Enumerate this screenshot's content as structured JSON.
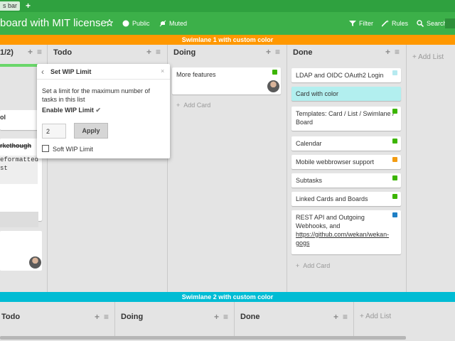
{
  "topbar": {
    "tab_label": "s bar",
    "add_tab": "+"
  },
  "header": {
    "board_title": "board with MIT license",
    "star_icon": "star-icon",
    "visibility": "Public",
    "notifications": "Muted",
    "filter": "Filter",
    "rules": "Rules",
    "search": "Search"
  },
  "swimlanes": [
    {
      "title": "Swimlane 1 with custom color",
      "color": "#ff9800",
      "lists": [
        {
          "title": "1/2)",
          "cards": [
            {
              "text": "ol"
            },
            {
              "text": "rkethough"
            },
            {
              "text": "eformatted"
            },
            {
              "text": "st"
            }
          ]
        },
        {
          "title": "Todo",
          "add_label": "+",
          "menu": "≡"
        },
        {
          "title": "Doing",
          "cards": [
            {
              "text": "More features",
              "label_color": "#3cb500"
            }
          ],
          "add_card": "Add Card"
        },
        {
          "title": "Done",
          "cards": [
            {
              "text": "LDAP and OIDC OAuth2 Login",
              "label_color": "#b6eaf0"
            },
            {
              "text": "Card with color",
              "card_color": "#b2efef"
            },
            {
              "text": "Templates: Card / List / Swimlane / Board",
              "label_color": "#3cb500"
            },
            {
              "text": "Calendar",
              "label_color": "#3cb500"
            },
            {
              "text": "Mobile webbrowser support",
              "label_color": "#f39c12"
            },
            {
              "text": "Subtasks",
              "label_color": "#3cb500"
            },
            {
              "text": "Linked Cards and Boards",
              "label_color": "#3cb500"
            },
            {
              "text": "REST API and Outgoing Webhooks, and",
              "link": "https://github.com/wekan/wekan-gogs",
              "label_color": "#1e7fc5"
            }
          ],
          "add_card": "Add Card"
        }
      ],
      "add_list": "Add List"
    },
    {
      "title": "Swimlane 2 with custom color",
      "color": "#00bcd4",
      "lists": [
        {
          "title": "Todo"
        },
        {
          "title": "Doing"
        },
        {
          "title": "Done"
        }
      ],
      "add_list": "Add List"
    }
  ],
  "wip_popup": {
    "title": "Set WIP Limit",
    "close": "×",
    "description": "Set a limit for the maximum number of tasks in this list",
    "enable_label": "Enable WIP Limit",
    "check": "✔",
    "value": "2",
    "apply": "Apply",
    "soft_label": "Soft WIP Limit"
  },
  "colors": {
    "header_green": "#3cb049",
    "list_bg": "#e4e4e4"
  }
}
